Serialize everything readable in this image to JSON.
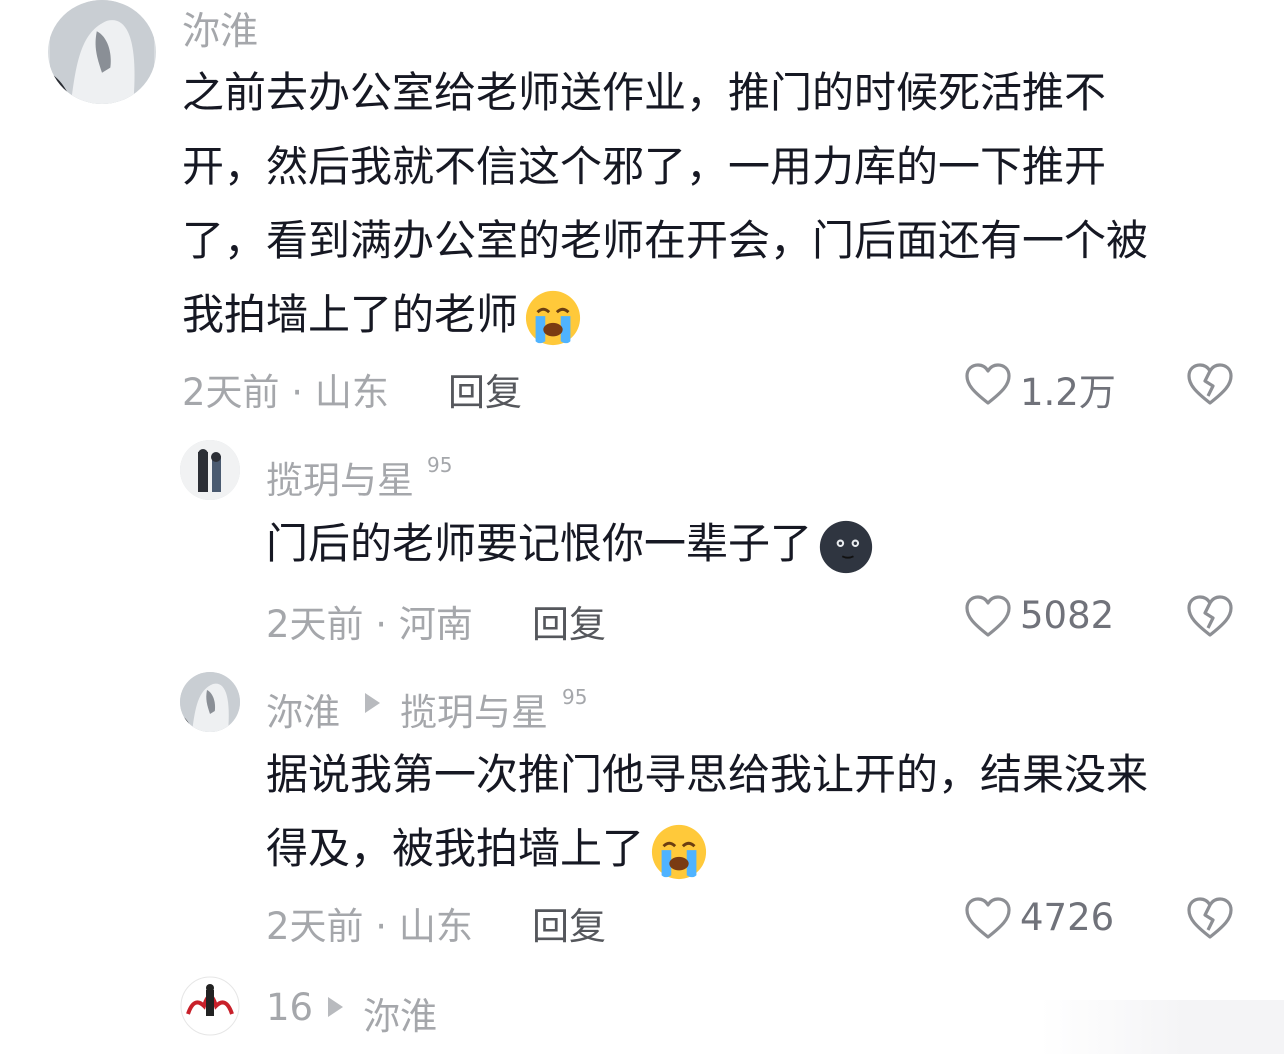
{
  "comments": [
    {
      "username": "沵淮",
      "text_lines": [
        "之前去办公室给老师送作业，推门的时候死活推不",
        "开，然后我就不信这个邪了，一用力库的一下推开",
        "了，看到满办公室的老师在开会，门后面还有一个被",
        "我拍墙上了的老师"
      ],
      "emoji": "loudly-crying-face",
      "meta": "2天前 · 山东",
      "reply_label": "回复",
      "likes": "1.2万"
    },
    {
      "username": "揽玥与星",
      "badge": "95",
      "text_lines": [
        "门后的老师要记恨你一辈子了"
      ],
      "emoji": "new-moon-face",
      "meta": "2天前 · 河南",
      "reply_label": "回复",
      "likes": "5082"
    },
    {
      "username": "沵淮",
      "reply_to": "揽玥与星",
      "badge": "95",
      "text_lines": [
        "据说我第一次推门他寻思给我让开的，结果没来",
        "得及，被我拍墙上了"
      ],
      "emoji": "loudly-crying-face",
      "meta": "2天前 · 山东",
      "reply_label": "回复",
      "likes": "4726"
    },
    {
      "username": "16",
      "reply_to": "沵淮"
    }
  ],
  "colors": {
    "primary_text": "#161823",
    "secondary_text": "#a5a7ab",
    "reply_text": "#55575c"
  }
}
